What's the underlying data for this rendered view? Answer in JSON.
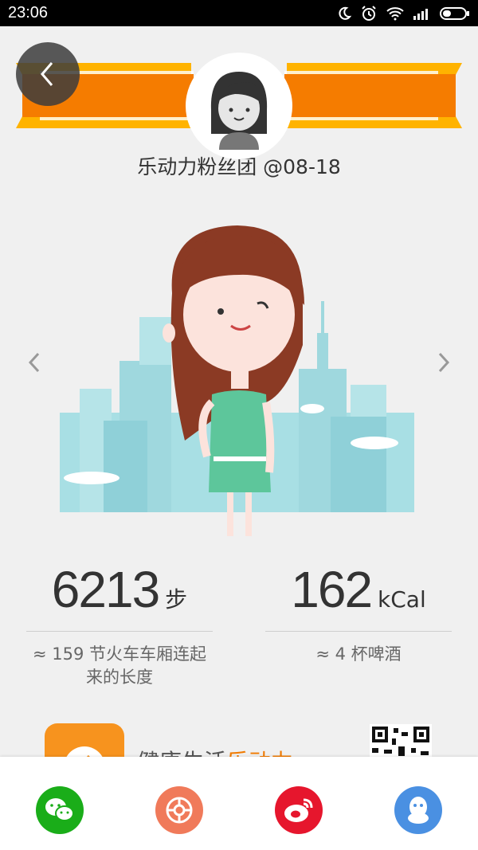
{
  "status": {
    "time": "23:06"
  },
  "header": {
    "group_name": "乐动力粉丝团 @08-18"
  },
  "stats": {
    "steps": {
      "value": "6213",
      "unit": "步",
      "desc": "≈ 159 节火车车厢连起来的长度"
    },
    "calories": {
      "value": "162",
      "unit": "kCal",
      "desc": "≈ 4 杯啤酒"
    }
  },
  "banner": {
    "text_main": "健康生活",
    "text_highlight": "乐动力"
  },
  "share": [
    {
      "name": "wechat",
      "color": "#1aad19"
    },
    {
      "name": "moments",
      "color": "#f07a5a"
    },
    {
      "name": "weibo",
      "color": "#e6162d"
    },
    {
      "name": "qq",
      "color": "#4a90e2"
    }
  ],
  "colors": {
    "ribbon": "#f57c00",
    "ribbon_light": "#ffb300",
    "dress": "#5dc69b",
    "hair": "#8b3a24",
    "city": "#a8dfe4"
  }
}
